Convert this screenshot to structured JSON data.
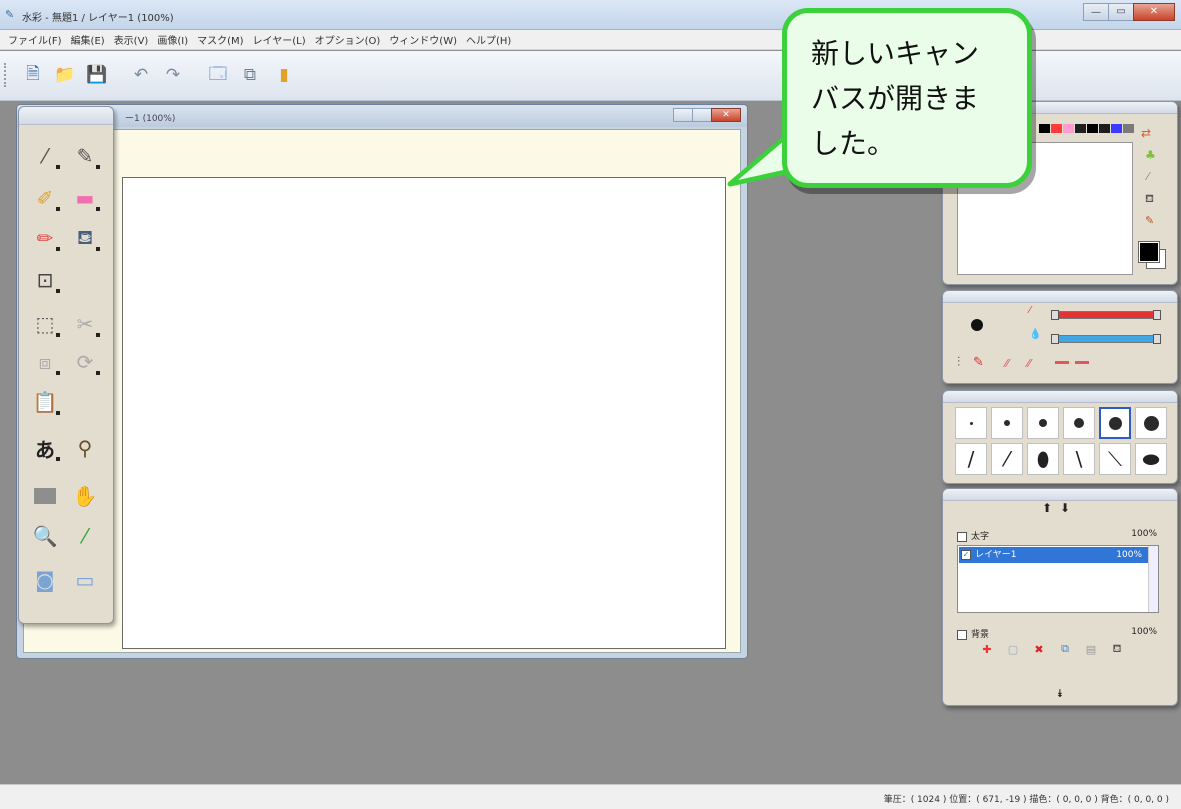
{
  "window": {
    "title": "水彩 - 無題1 / レイヤー1 (100%)",
    "buttons": [
      "minimize",
      "maximize",
      "close"
    ]
  },
  "menu": [
    "ファイル(F)",
    "編集(E)",
    "表示(V)",
    "画像(I)",
    "マスク(M)",
    "レイヤー(L)",
    "オプション(O)",
    "ウィンドウ(W)",
    "ヘルプ(H)"
  ],
  "toolbar": {
    "icons": [
      "new-document-icon",
      "open-folder-icon",
      "save-icon",
      "undo-icon",
      "redo-icon",
      "window-icon",
      "copy-icon",
      "layer-book-icon"
    ]
  },
  "canvas_window": {
    "title": "ー1    (100%)"
  },
  "tool_palette": {
    "icons": [
      "brush-icon",
      "pen-icon",
      "airbrush-icon",
      "eraser-icon",
      "pencil-icon",
      "fill-bucket-icon",
      "frame-icon",
      "rect-select-icon",
      "scissors-icon",
      "move-layer-icon",
      "rotate-icon",
      "paste-icon",
      "text-tool-icon",
      "stamp-icon",
      "gray-square-icon",
      "hand-icon",
      "magnifier-icon",
      "eyedropper-icon",
      "camera-icon",
      "monitor-icon"
    ],
    "text_tool_label": "あ"
  },
  "color_panel": {
    "palette_colors": [
      "#000000",
      "#ff3a3a",
      "#ff9bd0",
      "#d8d8d8",
      "#ffffff",
      "#1e1e1e",
      "#3bbd3b",
      "#ffffff",
      "#7a7a7a",
      "#3b3bff"
    ],
    "foreground": "#000000",
    "background": "#ffffff"
  },
  "brush_panel": {
    "slider_1_color": "#e33333",
    "slider_2_color": "#3fa7e6"
  },
  "size_panel": {
    "dot_sizes": [
      3,
      6,
      8,
      10,
      13,
      15
    ],
    "selected_index": 4
  },
  "layer_panel": {
    "top_row": {
      "name": "太字",
      "opacity": "100%"
    },
    "layers": [
      {
        "name": "レイヤー1",
        "opacity": "100%"
      }
    ],
    "paper_row": {
      "name": "背景",
      "opacity": "100%"
    }
  },
  "bubble": {
    "text": "新しいキャン\nバスが開きま\nした。"
  },
  "statusbar": {
    "text": "筆圧：( 1024 )  位置：( 671, -19 )  描色：( 0, 0, 0 )  背色：( 0, 0, 0 )"
  }
}
